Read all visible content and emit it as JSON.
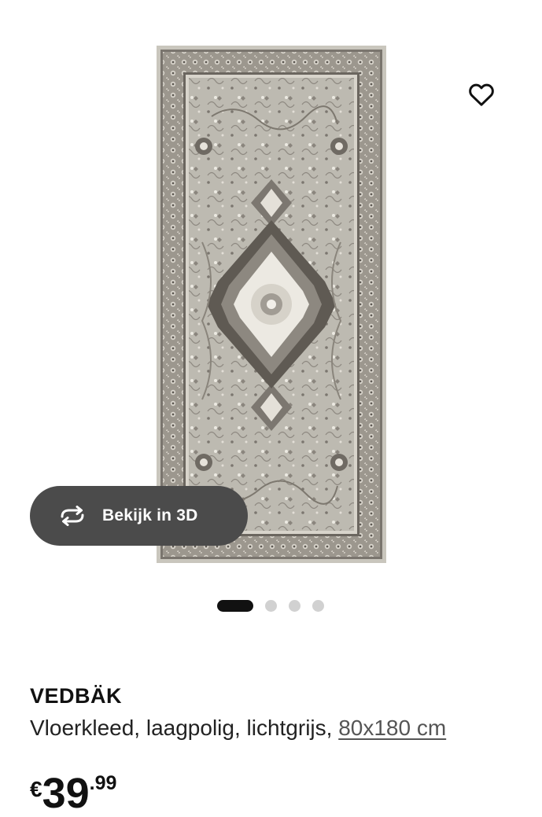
{
  "product": {
    "name": "VEDBÄK",
    "description_prefix": "Vloerkleed, laagpolig, lichtgrijs, ",
    "size": "80x180 cm",
    "price": {
      "currency": "€",
      "integer": "39",
      "decimal": ".99"
    }
  },
  "image": {
    "alt": "VEDBÄK vloerkleed",
    "gallery_count": 4,
    "active_index": 0
  },
  "actions": {
    "view_3d_label": "Bekijk in 3D",
    "favorite_icon": "heart-icon",
    "view_3d_icon": "rotate-3d-icon"
  },
  "colors": {
    "rug_base": "#b8b5ac",
    "rug_dark": "#6f6a63",
    "rug_light": "#e9e6df",
    "button_bg": "#4b4b4b",
    "dot_active": "#111111",
    "dot_inactive": "#d1d1d1"
  }
}
